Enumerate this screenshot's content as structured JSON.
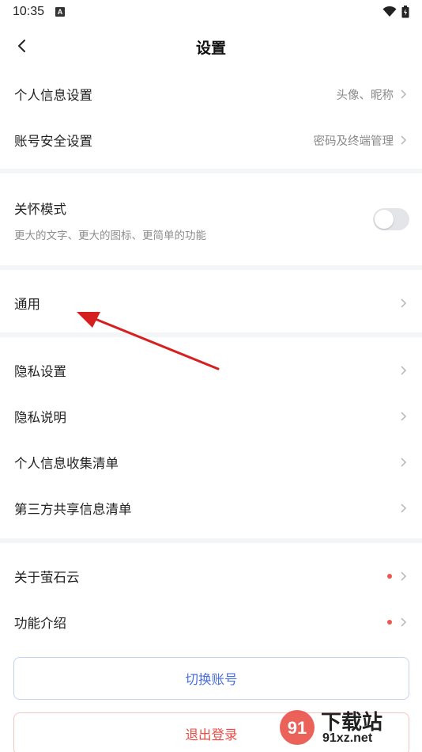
{
  "status_bar": {
    "time": "10:35"
  },
  "nav": {
    "title": "设置"
  },
  "account_group": [
    {
      "label": "个人信息设置",
      "value": "头像、昵称"
    },
    {
      "label": "账号安全设置",
      "value": "密码及终端管理"
    }
  ],
  "care_mode": {
    "title": "关怀模式",
    "description": "更大的文字、更大的图标、更简单的功能",
    "enabled": false
  },
  "general": {
    "label": "通用"
  },
  "privacy_group": [
    {
      "label": "隐私设置"
    },
    {
      "label": "隐私说明"
    },
    {
      "label": "个人信息收集清单"
    },
    {
      "label": "第三方共享信息清单"
    }
  ],
  "about_group": [
    {
      "label": "关于萤石云",
      "has_badge": true
    },
    {
      "label": "功能介绍",
      "has_badge": true
    }
  ],
  "buttons": {
    "switch_account": "切换账号",
    "logout": "退出登录"
  },
  "watermark": {
    "text": "下载站",
    "url": "91xz.net"
  },
  "colors": {
    "accent_blue": "#4a6fe0",
    "danger_red": "#ea4d45",
    "badge_red": "#f2554f",
    "annotation_arrow": "#d6201f"
  }
}
